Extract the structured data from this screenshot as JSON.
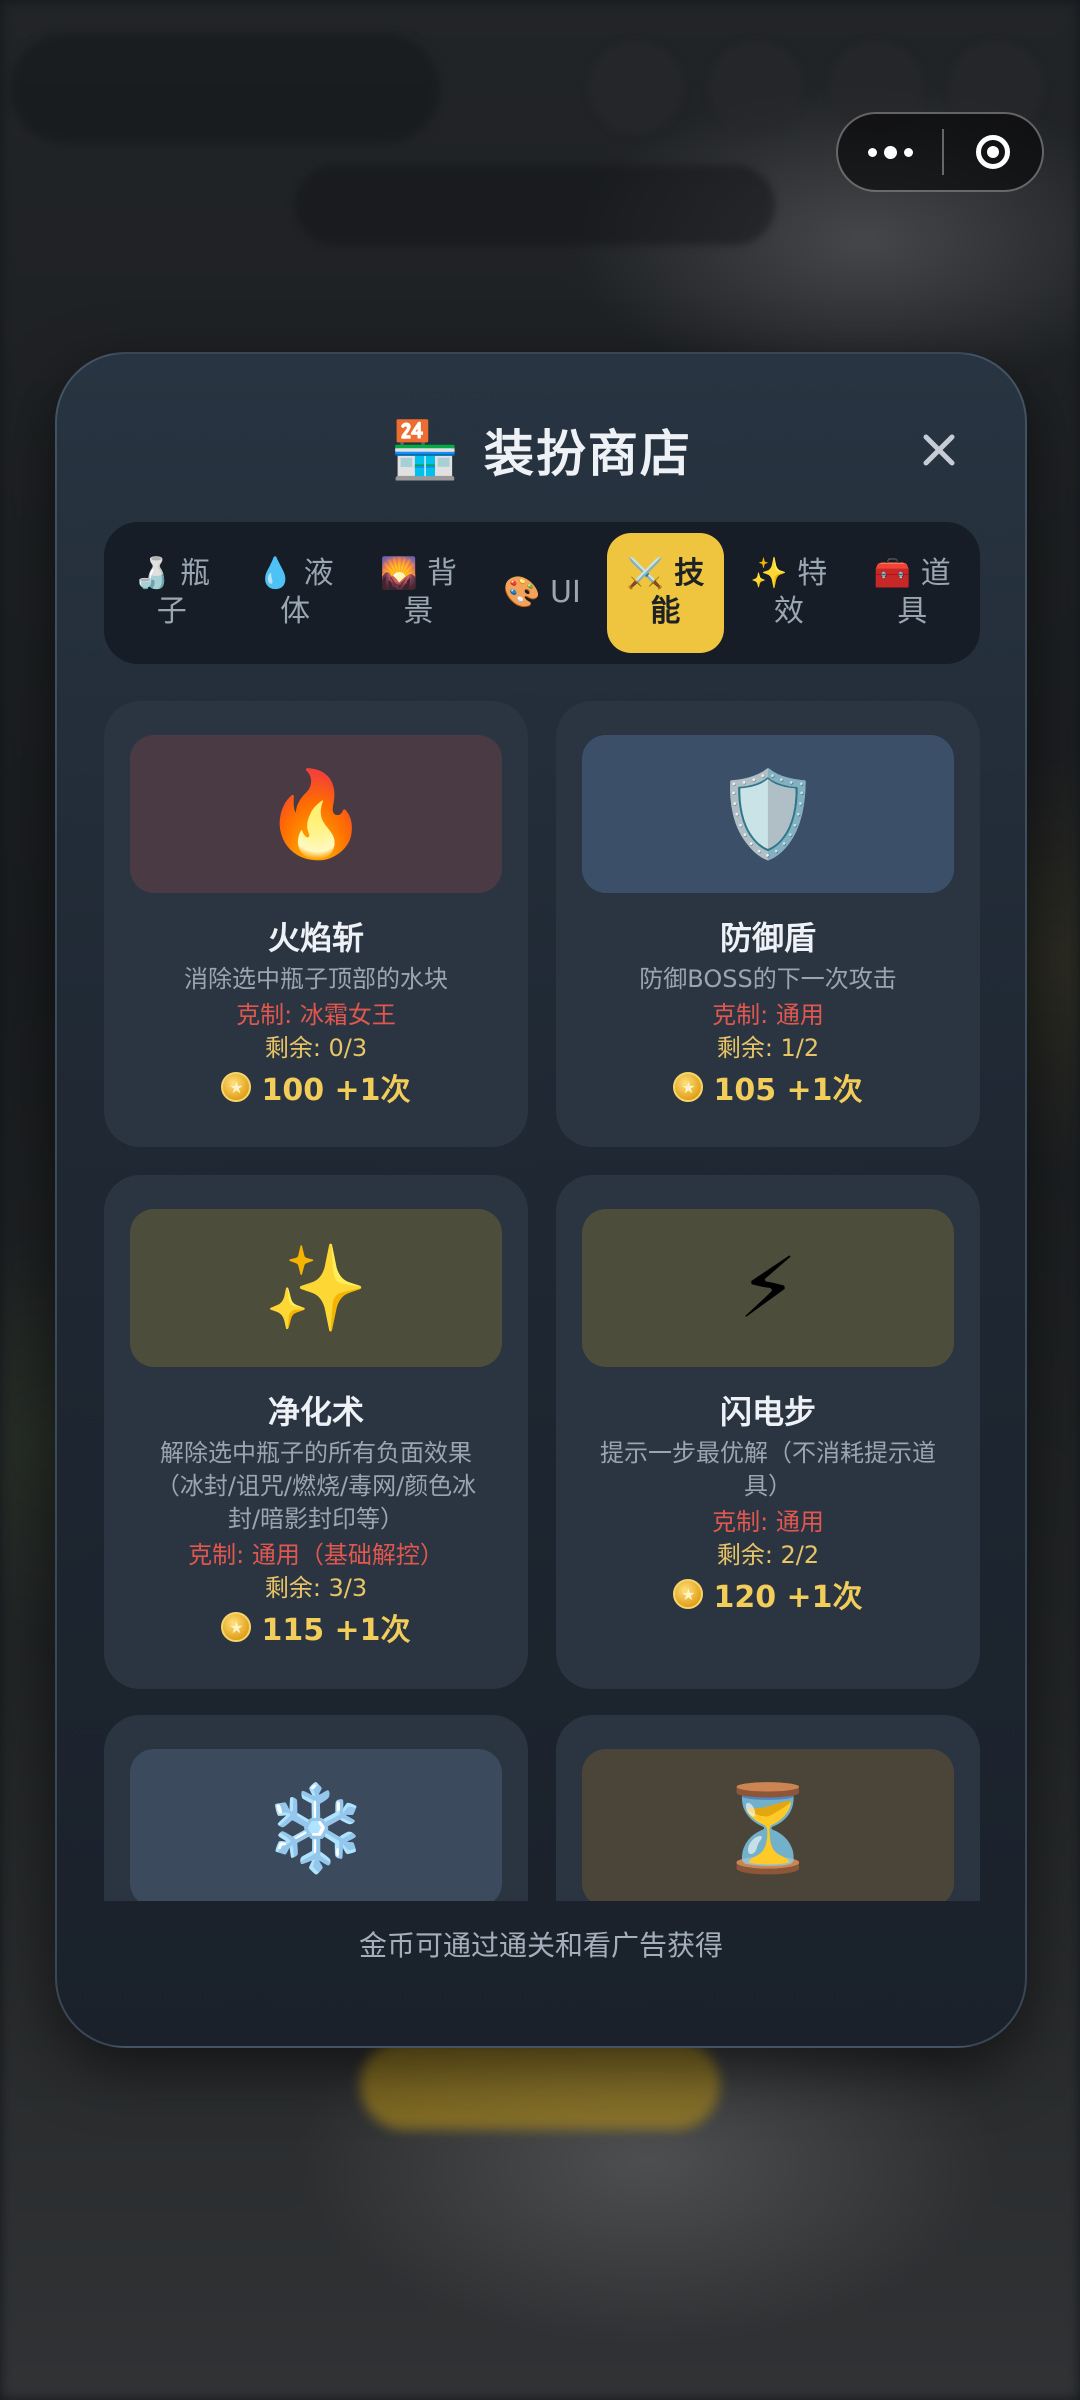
{
  "capsule": {
    "more_icon": "more-dots-icon",
    "close_icon": "target-circle-icon"
  },
  "shop": {
    "title_icon": "🏪",
    "title": "装扮商店",
    "close_icon": "✕"
  },
  "tabs": [
    {
      "icon": "🍶",
      "label": "瓶子",
      "active": false
    },
    {
      "icon": "💧",
      "label": "液体",
      "active": false
    },
    {
      "icon": "🌄",
      "label": "背景",
      "active": false
    },
    {
      "icon": "🎨",
      "label": "UI",
      "active": false
    },
    {
      "icon": "⚔️",
      "label": "技能",
      "active": true
    },
    {
      "icon": "✨",
      "label": "特效",
      "active": false
    },
    {
      "icon": "🧰",
      "label": "道具",
      "active": false
    }
  ],
  "items": [
    {
      "icon": "🔥",
      "icon_bg": "#4a3a43",
      "name": "火焰斩",
      "desc": "消除选中瓶子顶部的水块",
      "counter": "克制: 冰霜女王",
      "remain": "剩余: 0/3",
      "price": "100 +1次"
    },
    {
      "icon": "🛡️",
      "icon_bg": "#3b5068",
      "name": "防御盾",
      "desc": "防御BOSS的下一次攻击",
      "counter": "克制: 通用",
      "remain": "剩余: 1/2",
      "price": "105 +1次"
    },
    {
      "icon": "✨",
      "icon_bg": "#4d4d3b",
      "name": "净化术",
      "desc": "解除选中瓶子的所有负面效果（冰封/诅咒/燃烧/毒网/颜色冰封/暗影封印等）",
      "counter": "克制: 通用（基础解控）",
      "remain": "剩余: 3/3",
      "price": "115 +1次"
    },
    {
      "icon": "⚡",
      "icon_bg": "#4d4d3b",
      "name": "闪电步",
      "desc": "提示一步最优解（不消耗提示道具）",
      "counter": "克制: 通用",
      "remain": "剩余: 2/2",
      "price": "120 +1次"
    },
    {
      "icon": "❄️",
      "icon_bg": "#3b4a5c"
    },
    {
      "icon": "⏳",
      "icon_bg": "#4a4538"
    }
  ],
  "footer": "金币可通过通关和看广告获得",
  "colors": {
    "accent": "#efc43e",
    "counter_text": "#e0574f",
    "remain_text": "#e7c466",
    "price_text": "#f2cd5a"
  }
}
